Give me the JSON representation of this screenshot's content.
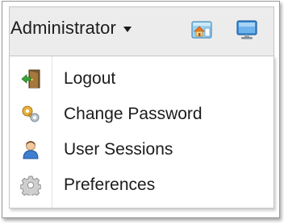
{
  "header": {
    "user_label": "Administrator",
    "icons": [
      "home-icon",
      "monitor-icon"
    ]
  },
  "menu": {
    "items": [
      {
        "label": "Logout",
        "icon": "logout-door-icon"
      },
      {
        "label": "Change Password",
        "icon": "key-icon"
      },
      {
        "label": "User Sessions",
        "icon": "user-icon"
      },
      {
        "label": "Preferences",
        "icon": "gear-icon"
      }
    ]
  },
  "colors": {
    "header_bg": "#ececec",
    "menu_bg": "#ffffff",
    "text": "#1c1c1c",
    "border": "#c4c4c4"
  }
}
